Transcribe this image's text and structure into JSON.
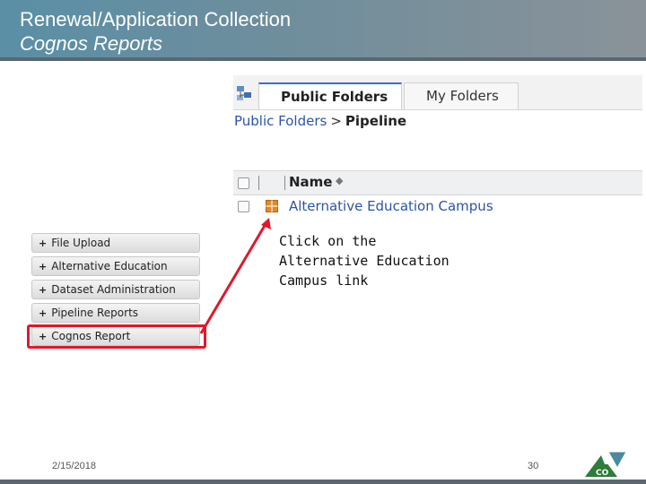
{
  "slide": {
    "title_line1": "Renewal/Application Collection",
    "title_line2": "Cognos Reports",
    "date": "2/15/2018",
    "page_number": "30",
    "logo_text": "CO"
  },
  "cognos": {
    "tabs": [
      {
        "label": "Public Folders",
        "active": true
      },
      {
        "label": "My Folders",
        "active": false
      }
    ],
    "breadcrumb": {
      "root": "Public Folders",
      "separator": ">",
      "current": "Pipeline"
    },
    "grid": {
      "column_name": "Name",
      "rows": [
        {
          "name": "Alternative Education Campus",
          "icon": "package-icon"
        }
      ]
    }
  },
  "callout": {
    "line1": "Click on the",
    "line2": "Alternative Education",
    "line3": "Campus link"
  },
  "nav_menu": {
    "items": [
      {
        "label": "File Upload"
      },
      {
        "label": "Alternative Education"
      },
      {
        "label": "Dataset Administration"
      },
      {
        "label": "Pipeline Reports"
      },
      {
        "label": "Cognos Report",
        "highlighted": true
      }
    ]
  },
  "colors": {
    "accent_link": "#2a55a8",
    "highlight_red": "#e0182a",
    "header_bg": "#6f8e9c"
  }
}
